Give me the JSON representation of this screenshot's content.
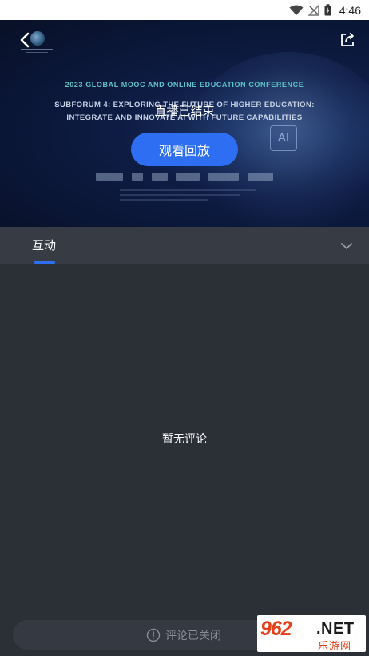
{
  "status_bar": {
    "time": "4:46",
    "icons": [
      "wifi-icon",
      "signal-off-icon",
      "battery-charging-icon"
    ]
  },
  "video": {
    "conference_title": "2023 GLOBAL MOOC AND ONLINE EDUCATION CONFERENCE",
    "subforum_line1": "SUBFORUM 4: EXPLORING THE     FUTURE OF HIGHER EDUCATION:",
    "subforum_line2": "INTEGRATE AND INNOVATE AI WITH FUTURE CAPABILITIES",
    "live_status": "直播已结束",
    "replay_button": "观看回放",
    "ai_label": "AI",
    "icons": {
      "back": "back-arrow-icon",
      "share": "share-icon"
    }
  },
  "tabs": {
    "active": "互动",
    "chevron": "chevron-down-icon"
  },
  "comments": {
    "empty_text": "暂无评论"
  },
  "bottom_bar": {
    "disabled_text": "评论已关闭",
    "icon": "info-circle-icon"
  },
  "watermark": {
    "number": "962",
    "net": ".NET",
    "cn": "乐游网"
  },
  "colors": {
    "accent": "#2e6ef2",
    "background": "#2b2f36",
    "tab_bar": "#373c44",
    "conf_title": "#5ec3c9"
  }
}
